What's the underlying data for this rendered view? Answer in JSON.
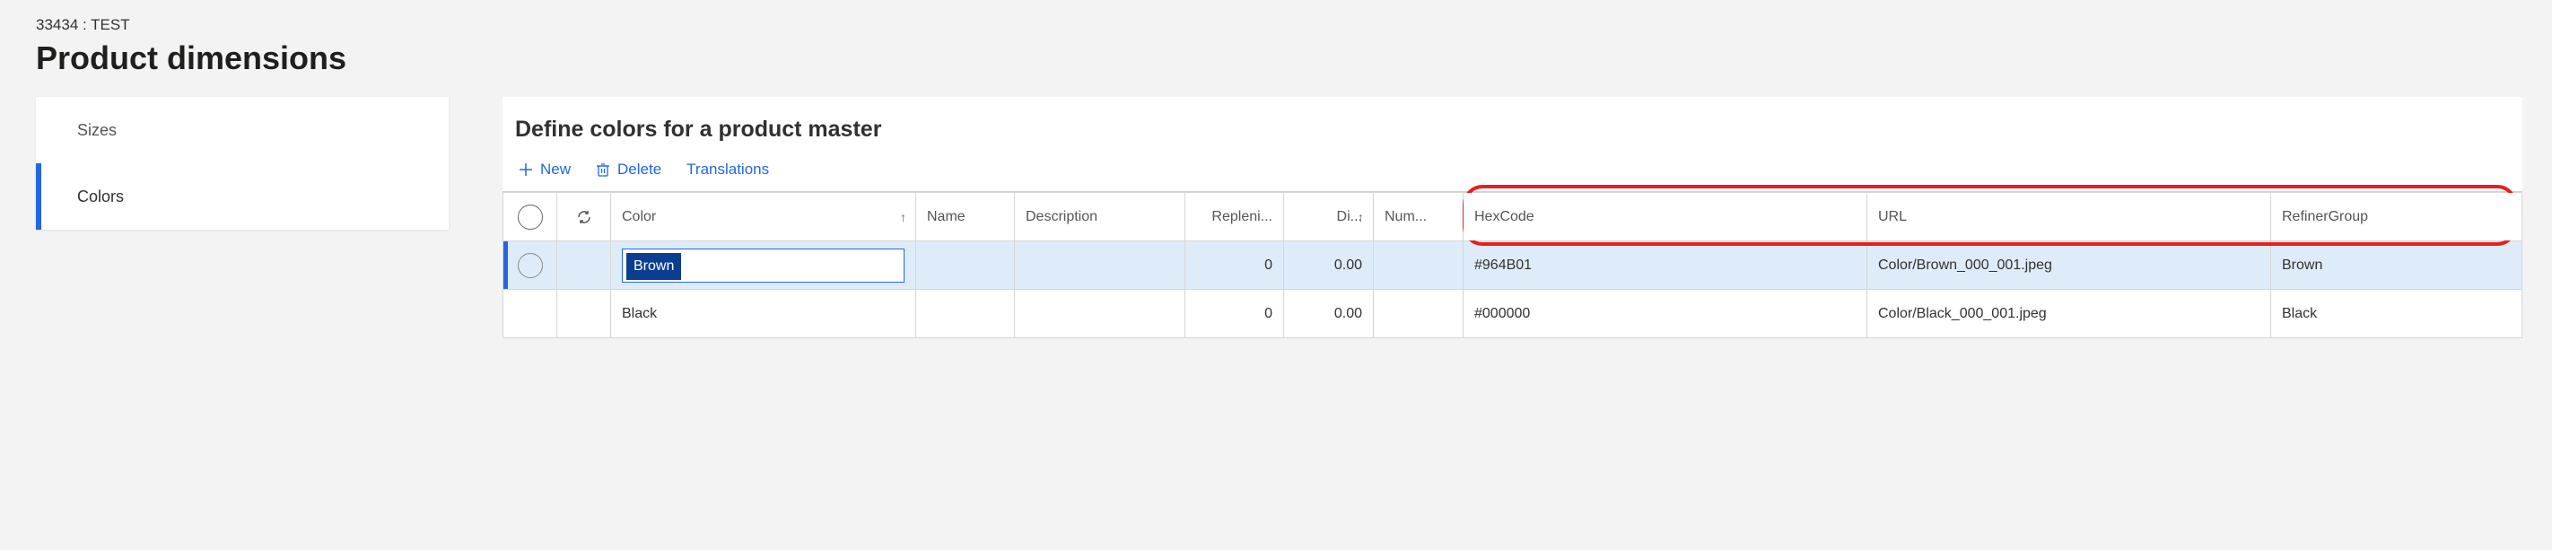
{
  "breadcrumb": "33434 : TEST",
  "page_title": "Product dimensions",
  "tabs": {
    "items": [
      {
        "label": "Sizes",
        "active": false
      },
      {
        "label": "Colors",
        "active": true
      }
    ]
  },
  "main": {
    "title": "Define colors for a product master",
    "toolbar": {
      "new_label": "New",
      "delete_label": "Delete",
      "translations_label": "Translations"
    },
    "columns": {
      "color": "Color",
      "name": "Name",
      "description": "Description",
      "replenishment": "Repleni...",
      "display": "Di...",
      "number": "Num...",
      "hex": "HexCode",
      "url": "URL",
      "refiner": "RefinerGroup"
    },
    "rows": [
      {
        "selected": true,
        "editing": true,
        "color": "Brown",
        "name": "",
        "description": "",
        "replenishment": "0",
        "display": "0.00",
        "number": "",
        "hex": "#964B01",
        "url": "Color/Brown_000_001.jpeg",
        "refiner": "Brown"
      },
      {
        "selected": false,
        "editing": false,
        "color": "Black",
        "name": "",
        "description": "",
        "replenishment": "0",
        "display": "0.00",
        "number": "",
        "hex": "#000000",
        "url": "Color/Black_000_001.jpeg",
        "refiner": "Black"
      }
    ]
  }
}
